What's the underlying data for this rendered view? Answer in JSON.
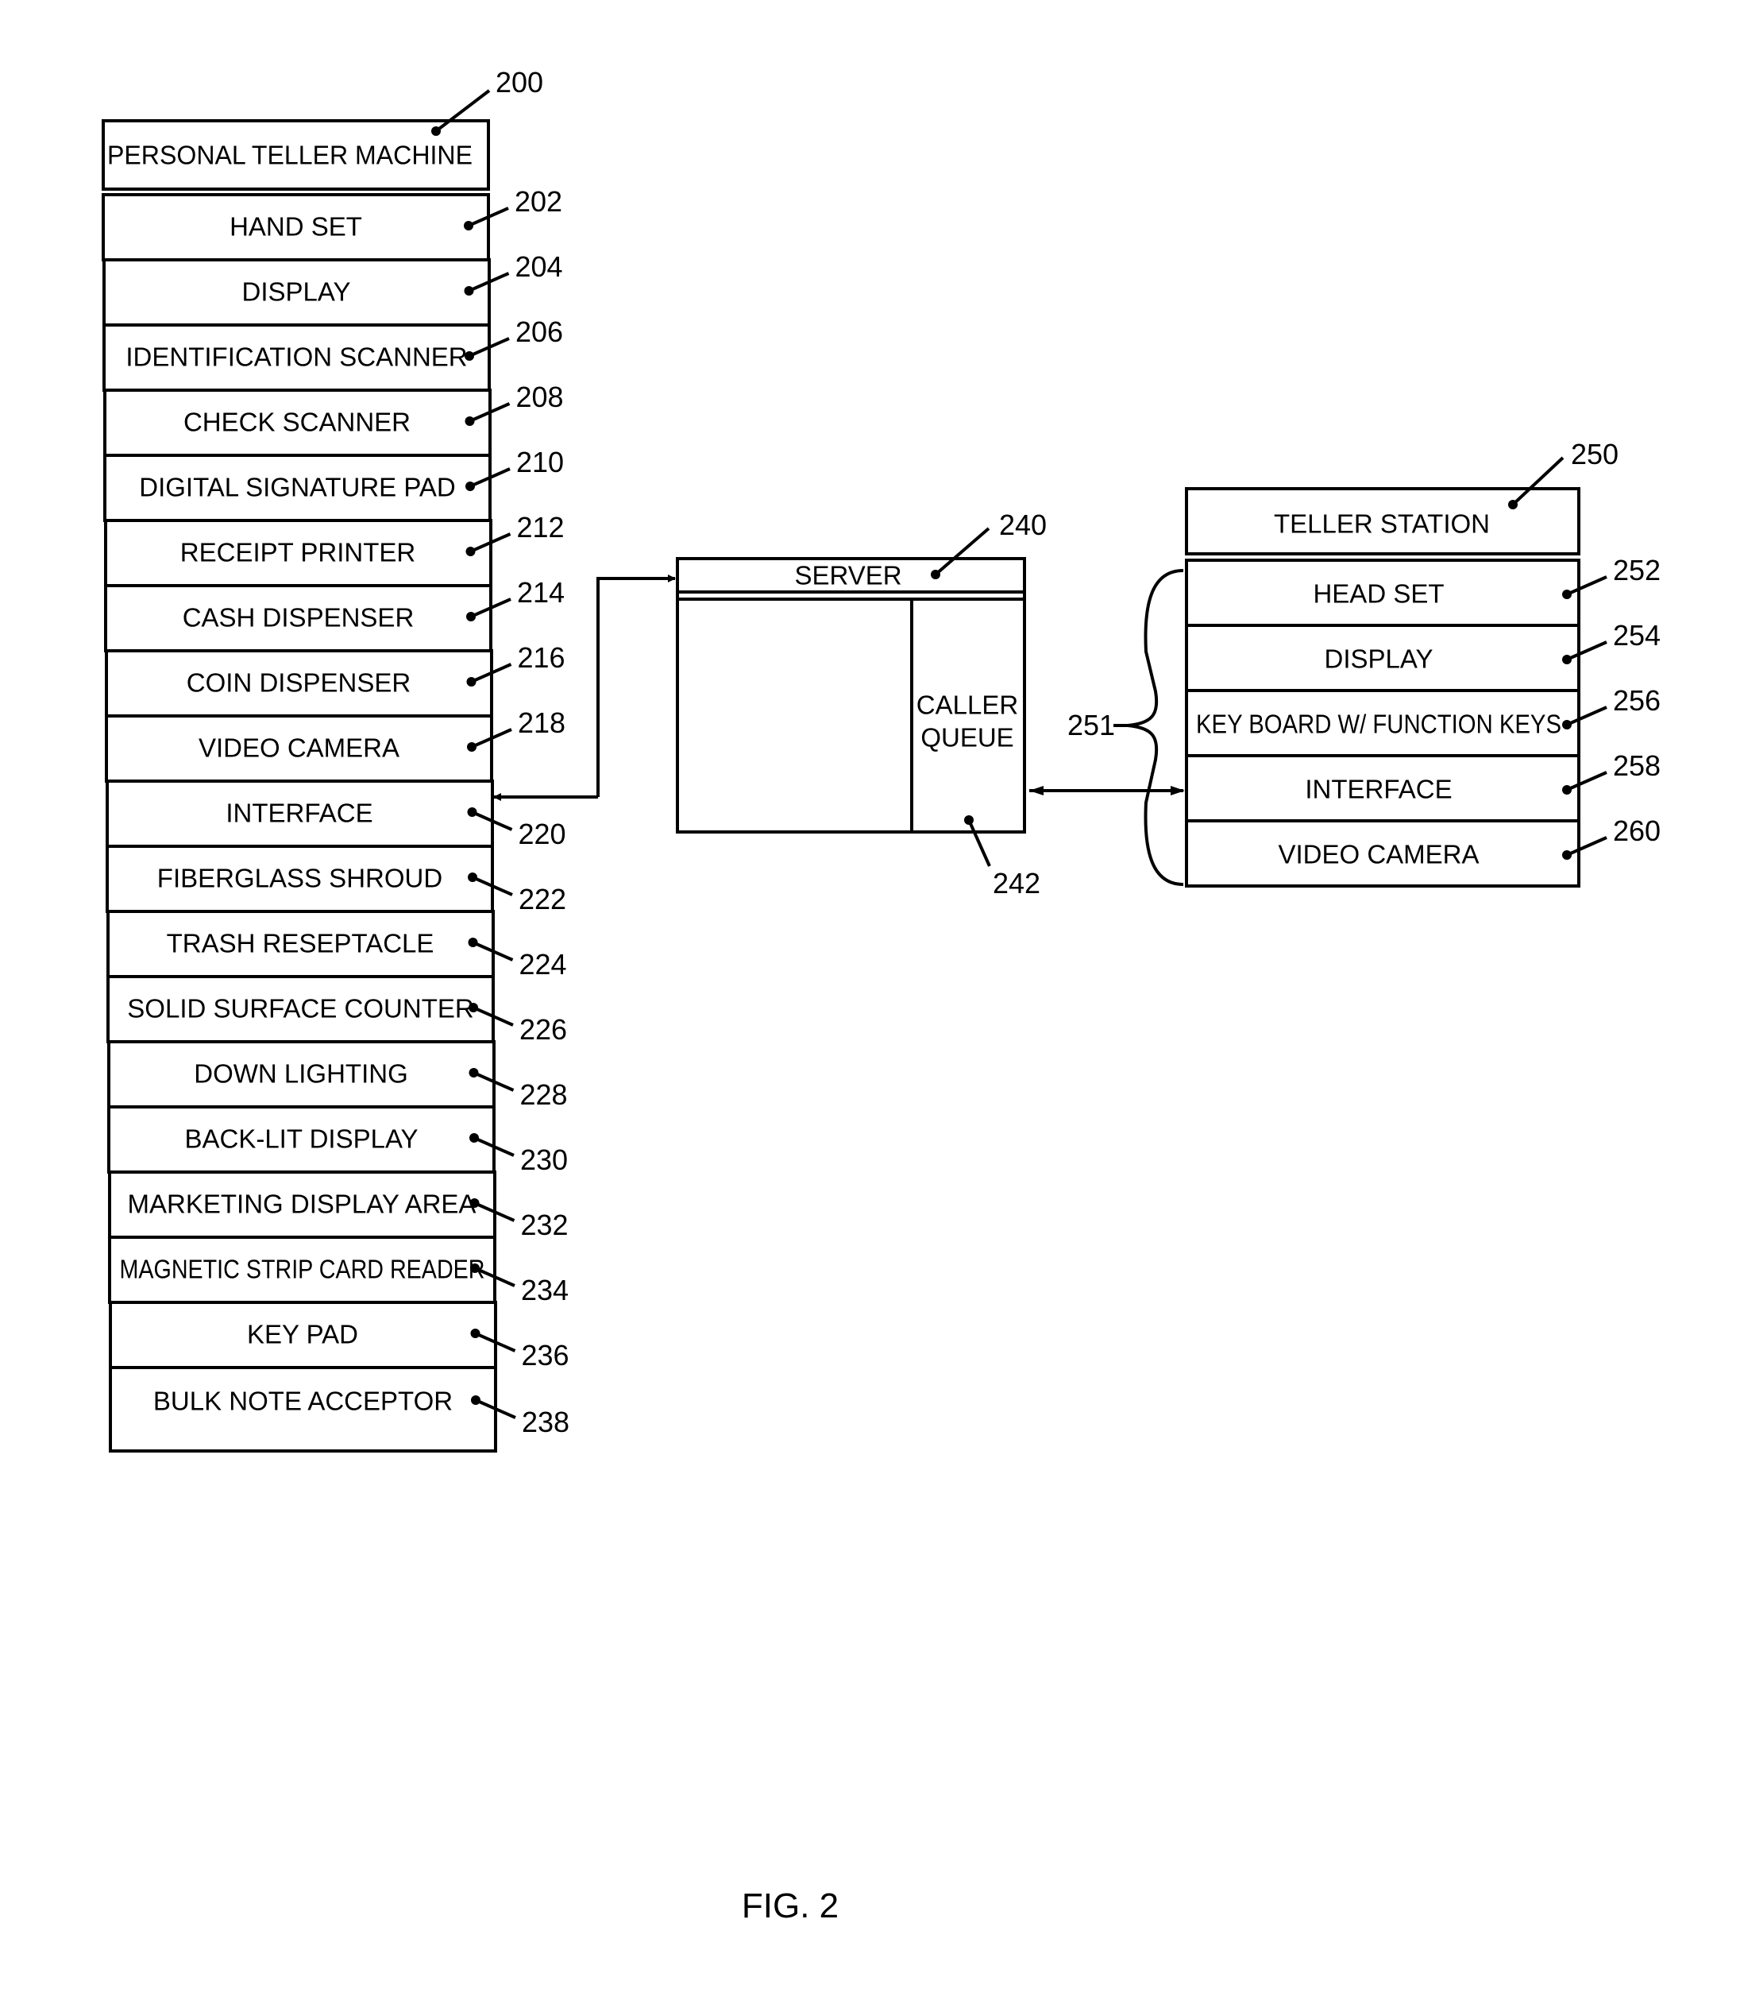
{
  "figure": {
    "caption": "FIG. 2"
  },
  "personal_teller_machine": {
    "title": "PERSONAL TELLER MACHINE",
    "ref": "200",
    "components": [
      {
        "label": "HAND SET",
        "ref": "202"
      },
      {
        "label": "DISPLAY",
        "ref": "204"
      },
      {
        "label": "IDENTIFICATION SCANNER",
        "ref": "206"
      },
      {
        "label": "CHECK SCANNER",
        "ref": "208"
      },
      {
        "label": "DIGITAL SIGNATURE PAD",
        "ref": "210"
      },
      {
        "label": "RECEIPT PRINTER",
        "ref": "212"
      },
      {
        "label": "CASH DISPENSER",
        "ref": "214"
      },
      {
        "label": "COIN DISPENSER",
        "ref": "216"
      },
      {
        "label": "VIDEO CAMERA",
        "ref": "218"
      },
      {
        "label": "INTERFACE",
        "ref": "220"
      },
      {
        "label": "FIBERGLASS SHROUD",
        "ref": "222"
      },
      {
        "label": "TRASH RESEPTACLE",
        "ref": "224"
      },
      {
        "label": "SOLID SURFACE COUNTER",
        "ref": "226"
      },
      {
        "label": "DOWN LIGHTING",
        "ref": "228"
      },
      {
        "label": "BACK-LIT DISPLAY",
        "ref": "230"
      },
      {
        "label": "MARKETING DISPLAY AREA",
        "ref": "232"
      },
      {
        "label": "MAGNETIC STRIP CARD READER",
        "ref": "234"
      },
      {
        "label": "KEY PAD",
        "ref": "236"
      },
      {
        "label": "BULK NOTE ACCEPTOR",
        "ref": "238"
      }
    ]
  },
  "server": {
    "title": "SERVER",
    "ref": "240",
    "caller_queue": {
      "line1": "CALLER",
      "line2": "QUEUE",
      "ref": "242"
    }
  },
  "teller_station": {
    "title": "TELLER STATION",
    "ref": "250",
    "group_ref": "251",
    "components": [
      {
        "label": "HEAD SET",
        "ref": "252"
      },
      {
        "label": "DISPLAY",
        "ref": "254"
      },
      {
        "label": "KEY BOARD W/ FUNCTION KEYS",
        "ref": "256"
      },
      {
        "label": "INTERFACE",
        "ref": "258"
      },
      {
        "label": "VIDEO CAMERA",
        "ref": "260"
      }
    ]
  },
  "connections": [
    {
      "from": "INTERFACE (220)",
      "to": "SERVER (240)",
      "type": "bidirectional"
    },
    {
      "from": "CALLER QUEUE (242)",
      "to": "INTERFACE (258)",
      "type": "bidirectional"
    }
  ]
}
